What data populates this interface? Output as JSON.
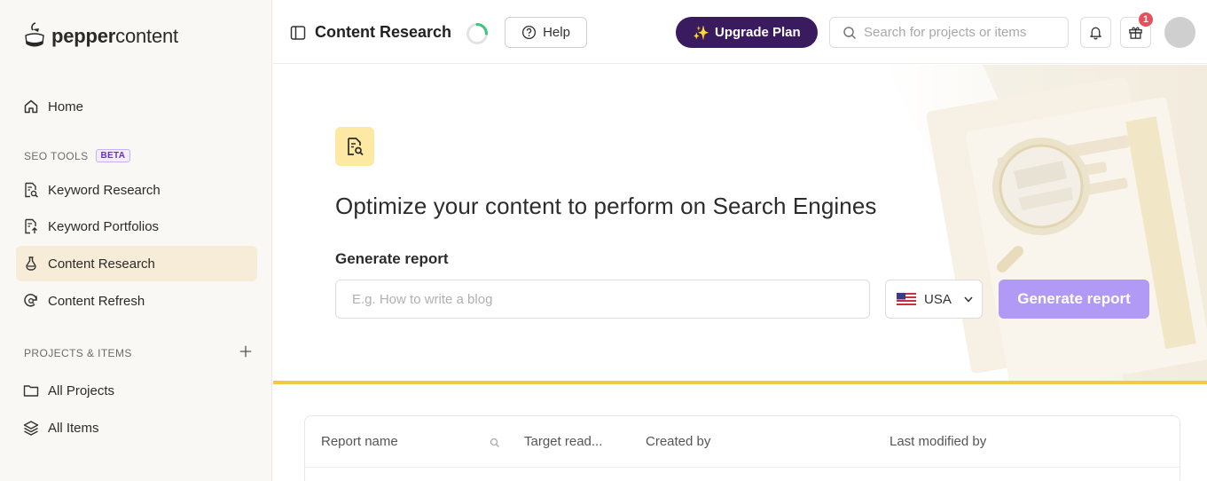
{
  "brand": {
    "name_bold": "pepper",
    "name_regular": "content"
  },
  "sidebar": {
    "home": "Home",
    "seo_section": "SEO TOOLS",
    "beta_badge": "BETA",
    "seo_items": [
      {
        "label": "Keyword Research"
      },
      {
        "label": "Keyword Portfolios"
      },
      {
        "label": "Content Research"
      },
      {
        "label": "Content Refresh"
      }
    ],
    "projects_section": "PROJECTS & ITEMS",
    "project_items": [
      {
        "label": "All Projects"
      },
      {
        "label": "All Items"
      }
    ]
  },
  "header": {
    "title": "Content Research",
    "help_label": "Help",
    "upgrade_label": "Upgrade Plan",
    "search_placeholder": "Search for projects or items",
    "notification_count": "1"
  },
  "hero": {
    "title": "Optimize your content to perform on Search Engines",
    "generate_label": "Generate report",
    "input_placeholder": "E.g. How to write a blog",
    "country": "USA",
    "generate_button": "Generate report"
  },
  "table": {
    "columns": [
      "Report name",
      "Target read...",
      "Created by",
      "Last modified by"
    ]
  },
  "colors": {
    "accent_purple": "#3b1b5f",
    "button_lavender": "#b09af5",
    "highlight_yellow": "#f2c84a",
    "active_nav": "#f6ecd8"
  },
  "icons": {
    "home": "home-icon",
    "keyword_research": "doc-search-icon",
    "keyword_portfolios": "doc-arrow-icon",
    "content_research": "flask-icon",
    "content_refresh": "refresh-search-icon",
    "all_projects": "folder-icon",
    "all_items": "layers-icon"
  }
}
